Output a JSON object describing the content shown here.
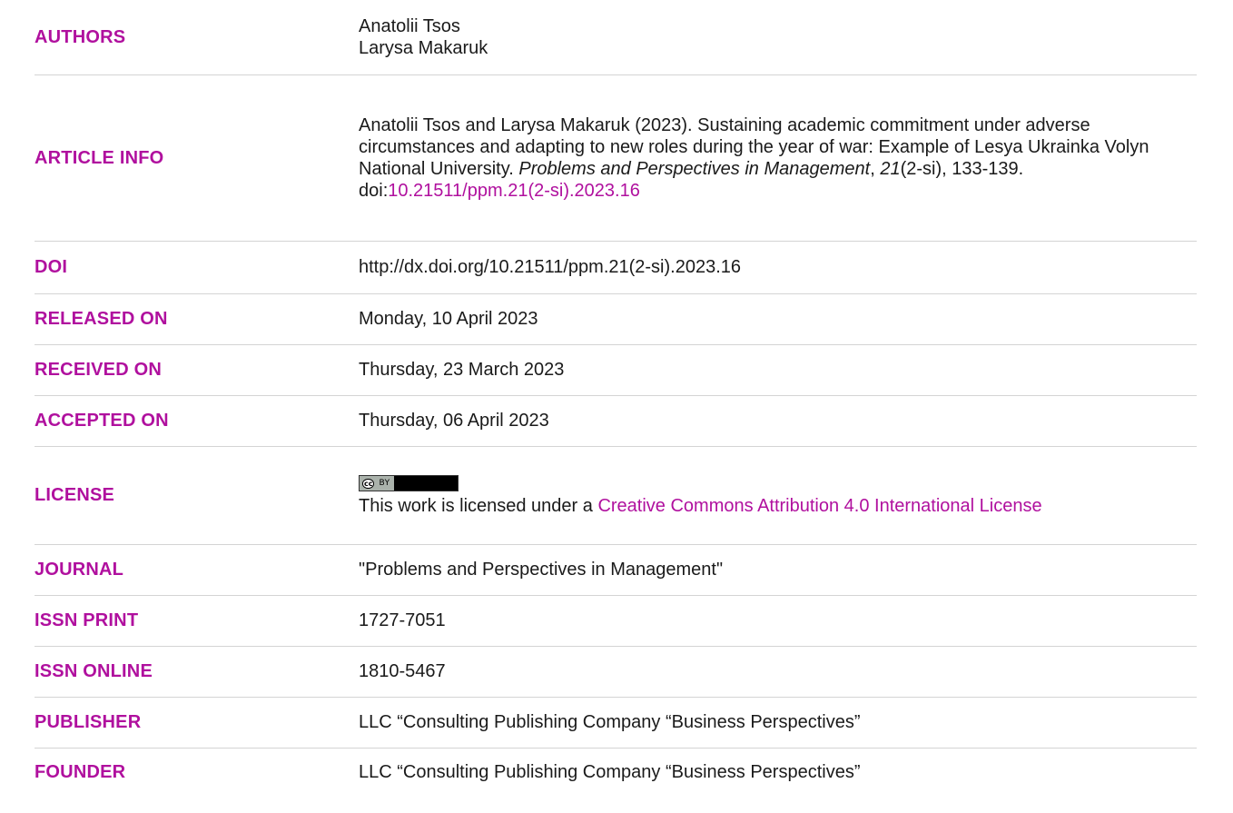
{
  "rows": {
    "authors": {
      "label": "AUTHORS",
      "values": [
        "Anatolii Tsos",
        "Larysa Makaruk"
      ]
    },
    "article_info": {
      "label": "ARTICLE INFO",
      "text_before": "Anatolii Tsos and Larysa Makaruk (2023). Sustaining academic commitment under adverse circumstances and adapting to new roles during the year of war: Example of Lesya Ukrainka Volyn National University. ",
      "journal_italic": "Problems and Perspectives in Management",
      "comma": ", ",
      "volume_italic": "21",
      "issue_pages": "(2-si), 133-139. doi:",
      "doi_link": "10.21511/ppm.21(2-si).2023.16"
    },
    "doi": {
      "label": "DOI",
      "value": "http://dx.doi.org/10.21511/ppm.21(2-si).2023.16"
    },
    "released_on": {
      "label": "RELEASED ON",
      "value": "Monday, 10 April 2023"
    },
    "received_on": {
      "label": "RECEIVED ON",
      "value": "Thursday, 23 March 2023"
    },
    "accepted_on": {
      "label": "ACCEPTED ON",
      "value": "Thursday, 06 April 2023"
    },
    "license": {
      "label": "LICENSE",
      "badge_cc": "cc",
      "badge_by": "BY",
      "text_before": "This work is licensed under a ",
      "link_text": "Creative Commons Attribution 4.0 International License"
    },
    "journal": {
      "label": "JOURNAL",
      "value": "\"Problems and Perspectives in Management\""
    },
    "issn_print": {
      "label": "ISSN PRINT",
      "value": "1727-7051"
    },
    "issn_online": {
      "label": "ISSN ONLINE",
      "value": "1810-5467"
    },
    "publisher": {
      "label": "PUBLISHER",
      "value": "LLC “Consulting Publishing Company “Business Perspectives”"
    },
    "founder": {
      "label": "FOUNDER",
      "value": "LLC “Consulting Publishing Company “Business Perspectives”"
    }
  },
  "colors": {
    "label": "#b0109e",
    "link": "#b0109e",
    "text": "#1a1a1a",
    "divider": "#d4d4d4"
  }
}
